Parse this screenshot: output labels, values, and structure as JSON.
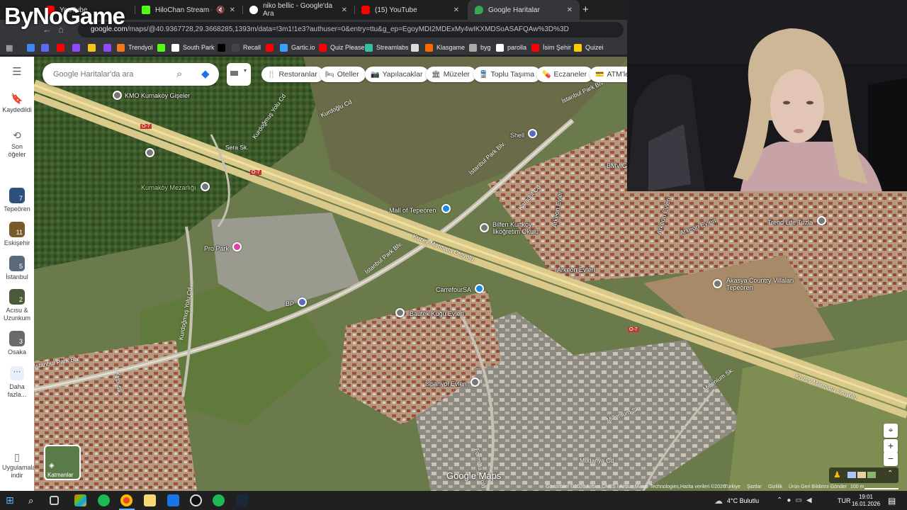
{
  "watermark": "ByNoGame",
  "tabs": [
    {
      "title": "YouTube",
      "color": "#ff0000"
    },
    {
      "title": "HiloChan Stream - Watch L",
      "color": "#53fc18"
    },
    {
      "title": "niko bellic - Google'da Ara",
      "color": "#ffffff"
    },
    {
      "title": "(15) YouTube",
      "color": "#ff0000"
    },
    {
      "title": "Google Haritalar",
      "color": "#34a853"
    }
  ],
  "url": {
    "host": "google.com",
    "path": "/maps/@40.9367728,29.3668285,1393m/data=!3m1!1e3?authuser=0&entry=ttu&g_ep=EgoyMDI2MDExMy4wIKXMDSoASAFQAw%3D%3D"
  },
  "bookmarks": [
    {
      "label": "",
      "color": "#4285f4"
    },
    {
      "label": "",
      "color": "#5b6af0"
    },
    {
      "label": "",
      "color": "#ff0000"
    },
    {
      "label": "",
      "color": "#9146ff"
    },
    {
      "label": "",
      "color": "#f5c518"
    },
    {
      "label": "",
      "color": "#9146ff"
    },
    {
      "label": "Trendyol",
      "color": "#f27a1a"
    },
    {
      "label": "",
      "color": "#53fc18"
    },
    {
      "label": "South Park",
      "color": "#ffffff"
    },
    {
      "label": "",
      "color": "#000000"
    },
    {
      "label": "Recall",
      "color": "#444444"
    },
    {
      "label": "",
      "color": "#ff0000"
    },
    {
      "label": "Gartic.io",
      "color": "#3aa0ff"
    },
    {
      "label": "Quiz Please",
      "color": "#ff0000"
    },
    {
      "label": "Streamlabs",
      "color": "#31c3a2"
    },
    {
      "label": "",
      "color": "#dddddd"
    },
    {
      "label": "Klasgame",
      "color": "#ff6a00"
    },
    {
      "label": "byg",
      "color": "#aaaaaa"
    },
    {
      "label": "parolla",
      "color": "#ffffff"
    },
    {
      "label": "İsim Şehir",
      "color": "#ff0000"
    },
    {
      "label": "Quizei",
      "color": "#ffcc00"
    }
  ],
  "sidebar": {
    "saved": "Kaydedildi",
    "recent": "Son öğeler",
    "places": [
      {
        "label": "Tepeören",
        "count": "7",
        "color": "#2c4f7c"
      },
      {
        "label": "Eskişehir",
        "count": "11",
        "color": "#7a5a2a"
      },
      {
        "label": "İstanbul",
        "count": "5",
        "color": "#5a6a7a"
      },
      {
        "label": "Acısu & Uzunkum",
        "count": "2",
        "color": "#4a5a3a"
      },
      {
        "label": "Osaka",
        "count": "3",
        "color": "#6a6a6a"
      }
    ],
    "more": "Daha fazla...",
    "apps": "Uygulamaları indir"
  },
  "search": {
    "placeholder": "Google Haritalar'da ara"
  },
  "chips": [
    {
      "label": "Restoranlar",
      "icon": "🍴"
    },
    {
      "label": "Oteller",
      "icon": "🛏"
    },
    {
      "label": "Yapılacaklar",
      "icon": "📷"
    },
    {
      "label": "Müzeler",
      "icon": "🏛"
    },
    {
      "label": "Toplu Taşıma",
      "icon": "🚆"
    },
    {
      "label": "Eczaneler",
      "icon": "💊"
    },
    {
      "label": "ATM'ler",
      "icon": "💳"
    }
  ],
  "places": {
    "kmo": "KMO Kurnaköy Gişeler",
    "mezarligi": "Kurnaköy Mezarlığı",
    "park": "Pro Park",
    "mall": "Mall of Tepeören",
    "shell": "Shell",
    "okul": "Bilfen Kurtköy İlköğretim Okulu",
    "bp": "BP",
    "carrefour": "CarrefourSA",
    "bautek": "Bautek Kuğu Evleri",
    "ispanyol": "İspanyol Evleri",
    "trend": "Trend Life Tuzla",
    "akasya": "Akasya Country Villaları Tepeören",
    "bmw": "BMV Ga",
    "arkeon1": "Arkeon Evleri",
    "arkeon2": "Arkeon Evleri",
    "arkeon3": "Arkeon Evleri",
    "arkeon4": "Arkeon Evleri"
  },
  "roads": {
    "o7a": "O-7",
    "o7b": "O-7",
    "o7c": "O-7",
    "kuzey1": "Kuzey Marmara Otoyolu",
    "kuzey2": "Kuzey Marmara Otoyolu",
    "istpark1": "İstanbul Park Blv.",
    "istpark2": "İstanbul Park Blv.",
    "istpark3": "İstanbul Park Blv.",
    "istpark4": "İstanbul Park Blv.",
    "kurdoglu1": "Kurdoğmuş Yolu Cd",
    "kurdoglu2": "Kurdoğmuş Yolu Cd",
    "kurdoglu3": "Kurdoğlu Cd",
    "sera": "Sera Sk.",
    "karadut": "Karadut Cd",
    "milenyum1": "Millenium Sk.",
    "milenyum2": "Millenium Sk.",
    "mudanya": "Mudanya Cd",
    "formula": "Formula 1 Yolu",
    "kirpi": "Kirpi Sk."
  },
  "map": {
    "brand": "Google Maps",
    "attribution": "Görüntüler ©2026 Airbus,CNES / Airbus,Maxar Technologies,Harita verileri ©2026",
    "links": [
      "Türkiye",
      "Şartlar",
      "Gizlilik",
      "Ürün Geri Bildirimi Gönder"
    ],
    "scale": "100 m",
    "layers": "Katmanlar"
  },
  "taskbar": {
    "weather": "4°C  Bulutlu",
    "lang": "TUR",
    "time": "19:01",
    "date": "16.01.2026"
  }
}
